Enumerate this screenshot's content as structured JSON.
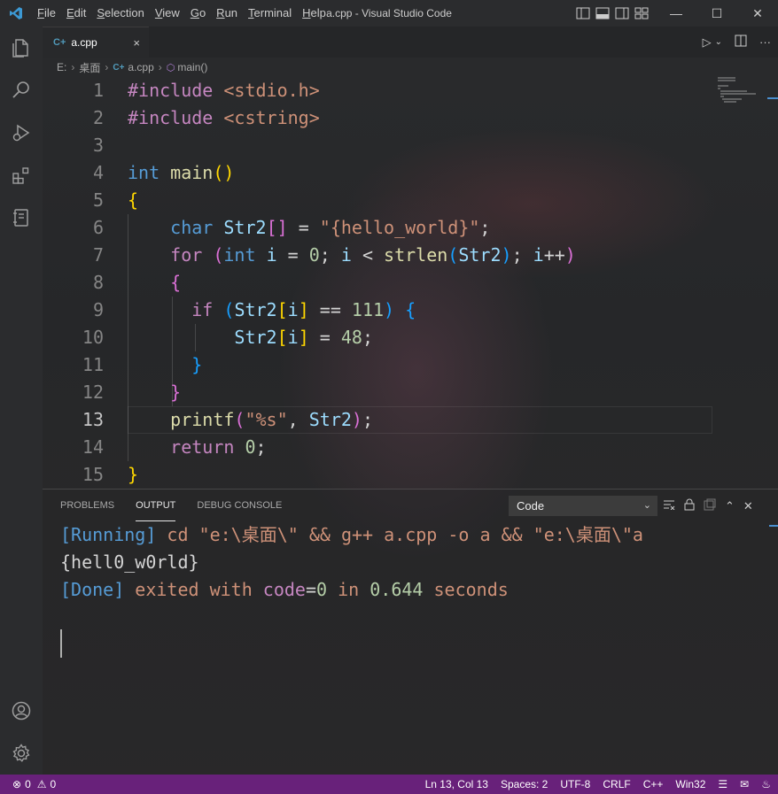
{
  "window": {
    "title": "a.cpp - Visual Studio Code",
    "menu": [
      {
        "label": "File",
        "u": "F",
        "rest": "ile"
      },
      {
        "label": "Edit",
        "u": "E",
        "rest": "dit"
      },
      {
        "label": "Selection",
        "u": "S",
        "rest": "election"
      },
      {
        "label": "View",
        "u": "V",
        "rest": "iew"
      },
      {
        "label": "Go",
        "u": "G",
        "rest": "o"
      },
      {
        "label": "Run",
        "u": "R",
        "rest": "un"
      },
      {
        "label": "Terminal",
        "u": "T",
        "rest": "erminal"
      },
      {
        "label": "Help",
        "u": "H",
        "rest": "elp"
      }
    ]
  },
  "tab": {
    "icon": "C+",
    "label": "a.cpp",
    "close": "×"
  },
  "breadcrumb": {
    "drive": "E:",
    "folder": "桌面",
    "file": "a.cpp",
    "symbol": "main()",
    "file_icon": "C+"
  },
  "editor": {
    "current_line": 13,
    "lines": [
      {
        "n": "1",
        "tokens": [
          [
            "pp",
            "#include"
          ],
          [
            "pl",
            " "
          ],
          [
            "inc",
            "<stdio.h>"
          ]
        ]
      },
      {
        "n": "2",
        "tokens": [
          [
            "pp",
            "#include"
          ],
          [
            "pl",
            " "
          ],
          [
            "inc",
            "<cstring>"
          ]
        ]
      },
      {
        "n": "3",
        "tokens": []
      },
      {
        "n": "4",
        "tokens": [
          [
            "ty",
            "int"
          ],
          [
            "pl",
            " "
          ],
          [
            "fn",
            "main"
          ],
          [
            "b1",
            "()"
          ]
        ]
      },
      {
        "n": "5",
        "tokens": [
          [
            "b1",
            "{"
          ]
        ]
      },
      {
        "n": "6",
        "tokens": [
          [
            "pl",
            "    "
          ],
          [
            "ty",
            "char"
          ],
          [
            "pl",
            " "
          ],
          [
            "va",
            "Str2"
          ],
          [
            "b2",
            "[]"
          ],
          [
            "pl",
            " = "
          ],
          [
            "st",
            "\"{hello_world}\""
          ],
          [
            "pl",
            ";"
          ]
        ]
      },
      {
        "n": "7",
        "tokens": [
          [
            "pl",
            "    "
          ],
          [
            "kw",
            "for"
          ],
          [
            "pl",
            " "
          ],
          [
            "b2",
            "("
          ],
          [
            "ty",
            "int"
          ],
          [
            "pl",
            " "
          ],
          [
            "va",
            "i"
          ],
          [
            "pl",
            " = "
          ],
          [
            "nu",
            "0"
          ],
          [
            "pl",
            "; "
          ],
          [
            "va",
            "i"
          ],
          [
            "pl",
            " < "
          ],
          [
            "fn",
            "strlen"
          ],
          [
            "b3",
            "("
          ],
          [
            "va",
            "Str2"
          ],
          [
            "b3",
            ")"
          ],
          [
            "pl",
            "; "
          ],
          [
            "va",
            "i"
          ],
          [
            "pl",
            "++"
          ],
          [
            "b2",
            ")"
          ]
        ]
      },
      {
        "n": "8",
        "tokens": [
          [
            "pl",
            "    "
          ],
          [
            "b2",
            "{"
          ]
        ]
      },
      {
        "n": "9",
        "tokens": [
          [
            "pl",
            "      "
          ],
          [
            "kw",
            "if"
          ],
          [
            "pl",
            " "
          ],
          [
            "b3",
            "("
          ],
          [
            "va",
            "Str2"
          ],
          [
            "b1",
            "["
          ],
          [
            "va",
            "i"
          ],
          [
            "b1",
            "]"
          ],
          [
            "pl",
            " == "
          ],
          [
            "nu",
            "111"
          ],
          [
            "b3",
            ")"
          ],
          [
            "pl",
            " "
          ],
          [
            "b3",
            "{"
          ]
        ]
      },
      {
        "n": "10",
        "tokens": [
          [
            "pl",
            "          "
          ],
          [
            "va",
            "Str2"
          ],
          [
            "b1",
            "["
          ],
          [
            "va",
            "i"
          ],
          [
            "b1",
            "]"
          ],
          [
            "pl",
            " = "
          ],
          [
            "nu",
            "48"
          ],
          [
            "pl",
            ";"
          ]
        ]
      },
      {
        "n": "11",
        "tokens": [
          [
            "pl",
            "      "
          ],
          [
            "b3",
            "}"
          ]
        ]
      },
      {
        "n": "12",
        "tokens": [
          [
            "pl",
            "    "
          ],
          [
            "b2",
            "}"
          ]
        ]
      },
      {
        "n": "13",
        "tokens": [
          [
            "pl",
            "    "
          ],
          [
            "fn",
            "printf"
          ],
          [
            "b2",
            "("
          ],
          [
            "st",
            "\"%s\""
          ],
          [
            "pl",
            ", "
          ],
          [
            "va",
            "Str2"
          ],
          [
            "b2",
            ")"
          ],
          [
            "pl",
            ";"
          ]
        ]
      },
      {
        "n": "14",
        "tokens": [
          [
            "pl",
            "    "
          ],
          [
            "kw",
            "return"
          ],
          [
            "pl",
            " "
          ],
          [
            "nu",
            "0"
          ],
          [
            "pl",
            ";"
          ]
        ]
      },
      {
        "n": "15",
        "tokens": [
          [
            "b1",
            "}"
          ]
        ]
      }
    ]
  },
  "panel": {
    "tabs": [
      "PROBLEMS",
      "OUTPUT",
      "DEBUG CONSOLE"
    ],
    "active_tab": "OUTPUT",
    "channel": "Code",
    "output": [
      [
        [
          "o-tag",
          "[Running]"
        ],
        [
          "o-path",
          " cd \"e:\\桌面\\\" && g++ a.cpp -o a && \"e:\\桌面\\\"a"
        ]
      ],
      [
        [
          "o-res",
          "{hell0_w0rld}"
        ]
      ],
      [
        [
          "o-tag",
          "[Done]"
        ],
        [
          "o-txt",
          " exited with "
        ],
        [
          "o-kw",
          "code"
        ],
        [
          "o-res",
          "="
        ],
        [
          "o-num",
          "0"
        ],
        [
          "o-txt",
          " in "
        ],
        [
          "o-num",
          "0.644"
        ],
        [
          "o-txt",
          " seconds"
        ]
      ]
    ]
  },
  "status": {
    "errors": "0",
    "warnings": "0",
    "position": "Ln 13, Col 13",
    "spaces": "Spaces: 2",
    "encoding": "UTF-8",
    "eol": "CRLF",
    "language": "C++",
    "platform": "Win32"
  },
  "colors": {
    "status_bar": "#68217a",
    "accent": "#007acc"
  }
}
